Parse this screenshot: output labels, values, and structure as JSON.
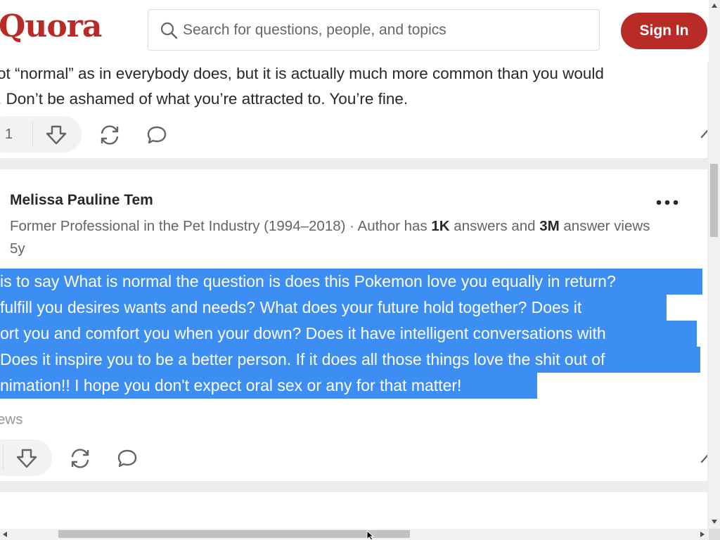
{
  "header": {
    "logo": "Quora",
    "search_placeholder": "Search for questions, people, and topics",
    "signin_label": "Sign In"
  },
  "answer1": {
    "text_line1": "ot “normal” as in everybody does, but it is actually much more common than you would",
    "text_line2": ". Don’t be ashamed of what you’re attracted to. You’re fine.",
    "upvote_count": "1"
  },
  "answer2": {
    "author": "Melissa Pauline Tem",
    "credential_prefix": "Former Professional in the Pet Industry (1994–2018) · Author has ",
    "answers_count": "1K",
    "answers_mid": " answers and ",
    "views_count": "3M",
    "views_suffix": " answer views",
    "time": "5y",
    "lines": [
      "is to say What is normal the question is does this Pokemon love you equally in return?",
      "fulfill you desires wants and needs? What does your future hold together? Does it",
      "ort you and comfort you when your down? Does it have intelligent conversations with",
      "Does it inspire you to be a better person. If it does all those things love the shit out of",
      "nimation!! I hope you don't expect oral sex or any for that matter!"
    ],
    "views_label": "ews"
  },
  "icons": [
    "search-icon",
    "downvote-icon",
    "share-icon",
    "comment-icon",
    "more-icon"
  ],
  "colors": {
    "brand": "#b92b27",
    "selection": "#3d8ef3"
  }
}
